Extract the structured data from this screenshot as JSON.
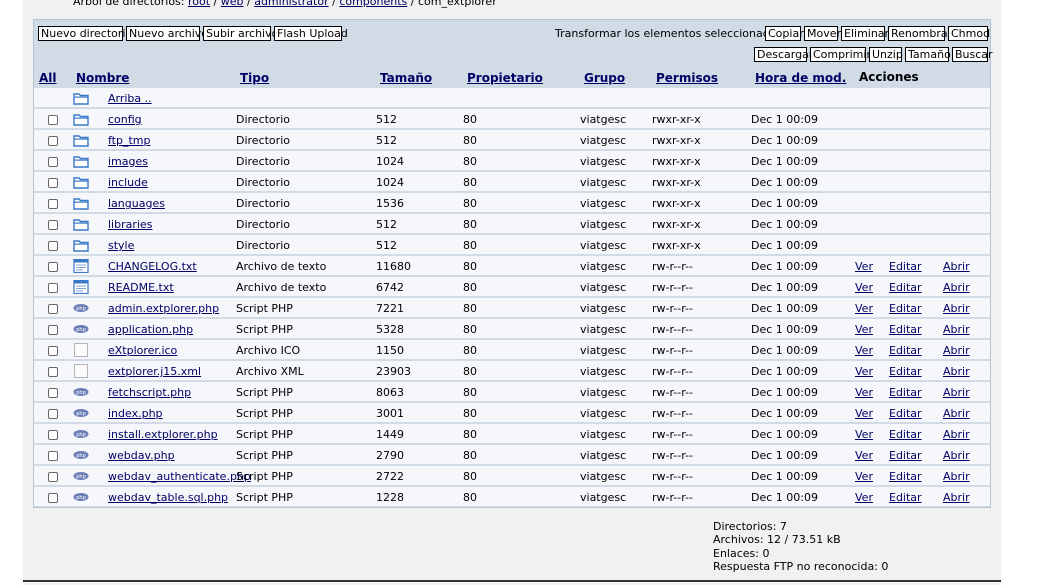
{
  "breadcrumb": {
    "prefix": "Árbol de directorios:",
    "parts": [
      "root",
      "web",
      "administrator",
      "components",
      "com_extplorer"
    ]
  },
  "toolbar": {
    "left_buttons": [
      "Nuevo directorio",
      "Nuevo archivo",
      "Subir archivo",
      "Flash Upload"
    ],
    "transform_label": "Transformar los elementos seleccionados:",
    "right_buttons_row1": [
      "Copiar",
      "Mover",
      "Eliminar",
      "Renombrar",
      "Chmod"
    ],
    "right_buttons_row2": [
      "Descargar",
      "Comprimir",
      "Unzip",
      "Tamaño",
      "Buscar"
    ]
  },
  "columns": {
    "all": "All",
    "name": "Nombre",
    "type": "Tipo",
    "size": "Tamaño",
    "owner": "Propietario",
    "group": "Grupo",
    "perms": "Permisos",
    "mtime": "Hora de mod.",
    "actions": "Acciones"
  },
  "up_row": {
    "label": "Arriba .."
  },
  "action_labels": {
    "view": "Ver",
    "edit": "Editar",
    "open": "Abrir"
  },
  "rows": [
    {
      "name": "config",
      "type": "Directorio",
      "size": "512",
      "owner": "80",
      "group": "viatgesc",
      "perms": "rwxr-xr-x",
      "mtime": "Dec 1 00:09",
      "icon": "folder-icon",
      "actions": false
    },
    {
      "name": "ftp_tmp",
      "type": "Directorio",
      "size": "512",
      "owner": "80",
      "group": "viatgesc",
      "perms": "rwxr-xr-x",
      "mtime": "Dec 1 00:09",
      "icon": "folder-icon",
      "actions": false
    },
    {
      "name": "images",
      "type": "Directorio",
      "size": "1024",
      "owner": "80",
      "group": "viatgesc",
      "perms": "rwxr-xr-x",
      "mtime": "Dec 1 00:09",
      "icon": "folder-icon",
      "actions": false
    },
    {
      "name": "include",
      "type": "Directorio",
      "size": "1024",
      "owner": "80",
      "group": "viatgesc",
      "perms": "rwxr-xr-x",
      "mtime": "Dec 1 00:09",
      "icon": "folder-icon",
      "actions": false
    },
    {
      "name": "languages",
      "type": "Directorio",
      "size": "1536",
      "owner": "80",
      "group": "viatgesc",
      "perms": "rwxr-xr-x",
      "mtime": "Dec 1 00:09",
      "icon": "folder-icon",
      "actions": false
    },
    {
      "name": "libraries",
      "type": "Directorio",
      "size": "512",
      "owner": "80",
      "group": "viatgesc",
      "perms": "rwxr-xr-x",
      "mtime": "Dec 1 00:09",
      "icon": "folder-icon",
      "actions": false
    },
    {
      "name": "style",
      "type": "Directorio",
      "size": "512",
      "owner": "80",
      "group": "viatgesc",
      "perms": "rwxr-xr-x",
      "mtime": "Dec 1 00:09",
      "icon": "folder-icon",
      "actions": false
    },
    {
      "name": "CHANGELOG.txt",
      "type": "Archivo de texto",
      "size": "11680",
      "owner": "80",
      "group": "viatgesc",
      "perms": "rw-r--r--",
      "mtime": "Dec 1 00:09",
      "icon": "text-file-icon",
      "actions": true
    },
    {
      "name": "README.txt",
      "type": "Archivo de texto",
      "size": "6742",
      "owner": "80",
      "group": "viatgesc",
      "perms": "rw-r--r--",
      "mtime": "Dec 1 00:09",
      "icon": "text-file-icon",
      "actions": true
    },
    {
      "name": "admin.extplorer.php",
      "type": "Script PHP",
      "size": "7221",
      "owner": "80",
      "group": "viatgesc",
      "perms": "rw-r--r--",
      "mtime": "Dec 1 00:09",
      "icon": "php-file-icon",
      "actions": true
    },
    {
      "name": "application.php",
      "type": "Script PHP",
      "size": "5328",
      "owner": "80",
      "group": "viatgesc",
      "perms": "rw-r--r--",
      "mtime": "Dec 1 00:09",
      "icon": "php-file-icon",
      "actions": true
    },
    {
      "name": "eXtplorer.ico",
      "type": "Archivo ICO",
      "size": "1150",
      "owner": "80",
      "group": "viatgesc",
      "perms": "rw-r--r--",
      "mtime": "Dec 1 00:09",
      "icon": "blank-file-icon",
      "actions": true
    },
    {
      "name": "extplorer.j15.xml",
      "type": "Archivo XML",
      "size": "23903",
      "owner": "80",
      "group": "viatgesc",
      "perms": "rw-r--r--",
      "mtime": "Dec 1 00:09",
      "icon": "blank-file-icon",
      "actions": true
    },
    {
      "name": "fetchscript.php",
      "type": "Script PHP",
      "size": "8063",
      "owner": "80",
      "group": "viatgesc",
      "perms": "rw-r--r--",
      "mtime": "Dec 1 00:09",
      "icon": "php-file-icon",
      "actions": true
    },
    {
      "name": "index.php",
      "type": "Script PHP",
      "size": "3001",
      "owner": "80",
      "group": "viatgesc",
      "perms": "rw-r--r--",
      "mtime": "Dec 1 00:09",
      "icon": "php-file-icon",
      "actions": true
    },
    {
      "name": "install.extplorer.php",
      "type": "Script PHP",
      "size": "1449",
      "owner": "80",
      "group": "viatgesc",
      "perms": "rw-r--r--",
      "mtime": "Dec 1 00:09",
      "icon": "php-file-icon",
      "actions": true
    },
    {
      "name": "webdav.php",
      "type": "Script PHP",
      "size": "2790",
      "owner": "80",
      "group": "viatgesc",
      "perms": "rw-r--r--",
      "mtime": "Dec 1 00:09",
      "icon": "php-file-icon",
      "actions": true
    },
    {
      "name": "webdav_authenticate.php",
      "type": "Script PHP",
      "size": "2722",
      "owner": "80",
      "group": "viatgesc",
      "perms": "rw-r--r--",
      "mtime": "Dec 1 00:09",
      "icon": "php-file-icon",
      "actions": true
    },
    {
      "name": "webdav_table.sql.php",
      "type": "Script PHP",
      "size": "1228",
      "owner": "80",
      "group": "viatgesc",
      "perms": "rw-r--r--",
      "mtime": "Dec 1 00:09",
      "icon": "php-file-icon",
      "actions": true
    }
  ],
  "summary": {
    "dirs": "Directorios: 7",
    "files": "Archivos: 12 / 73.51 kB",
    "links": "Enlaces: 0",
    "ftp": "Respuesta FTP no reconocida: 0"
  },
  "colors": {
    "panel_bg": "#d0dbe6",
    "row_bg": "#f5f7fa",
    "link": "#000066",
    "folder_blue": "#3a78c8"
  }
}
